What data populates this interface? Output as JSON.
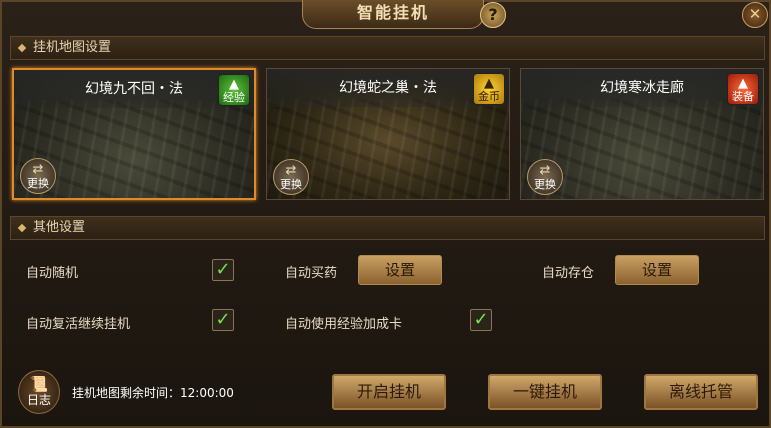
{
  "window": {
    "title": "智能挂机",
    "help_icon": "?",
    "close_icon": "✕"
  },
  "map_section": {
    "title": "挂机地图设置",
    "maps": [
      {
        "name": "幻境九不回・法",
        "badge": "经验",
        "badge_color": "#3fa02a",
        "swap_label": "更换",
        "selected": true
      },
      {
        "name": "幻境蛇之巢・法",
        "badge": "金币",
        "badge_color": "#e0a818",
        "swap_label": "更换",
        "selected": false
      },
      {
        "name": "幻境寒冰走廊",
        "badge": "装备",
        "badge_color": "#d03a18",
        "swap_label": "更换",
        "selected": false
      }
    ]
  },
  "other_section": {
    "title": "其他设置",
    "auto_random": {
      "label": "自动随机",
      "checked": true
    },
    "auto_buy_potion": {
      "label": "自动买药",
      "button": "设置"
    },
    "auto_store": {
      "label": "自动存仓",
      "button": "设置"
    },
    "auto_revive": {
      "label": "自动复活继续挂机",
      "checked": true
    },
    "auto_exp_card": {
      "label": "自动使用经验加成卡",
      "checked": true
    }
  },
  "footer": {
    "log_label": "日志",
    "timer_label": "挂机地图剩余时间：",
    "timer_value": "12:00:00",
    "start_button": "开启挂机",
    "oneclick_button": "一键挂机",
    "offline_button": "离线托管"
  }
}
